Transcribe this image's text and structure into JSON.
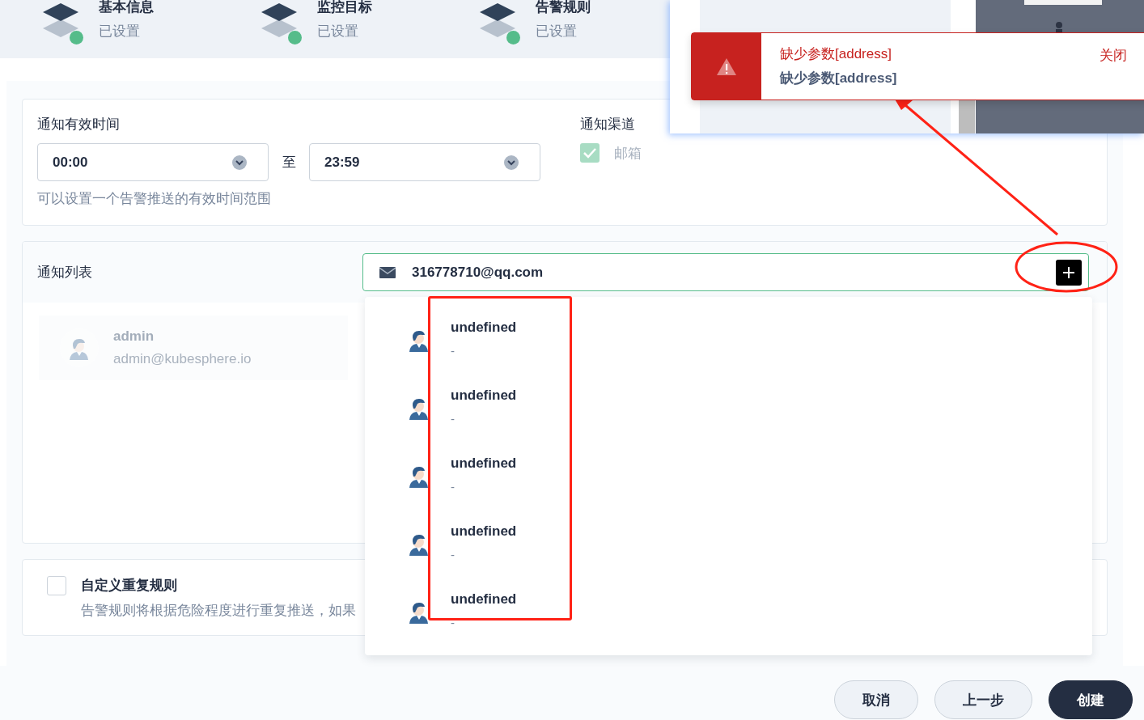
{
  "steps": [
    {
      "title": "基本信息",
      "status": "已设置",
      "done": true
    },
    {
      "title": "监控目标",
      "status": "已设置",
      "done": true
    },
    {
      "title": "告警规则",
      "status": "已设置",
      "done": true
    }
  ],
  "time_card": {
    "label": "通知有效时间",
    "start": "00:00",
    "separator": "至",
    "end": "23:59",
    "hint": "可以设置一个告警推送的有效时间范围"
  },
  "channels": {
    "label": "通知渠道",
    "items": [
      {
        "label": "邮箱",
        "checked": true,
        "disabled": true
      }
    ]
  },
  "notify_list": {
    "label": "通知列表",
    "input_value": "316778710@qq.com",
    "users": [
      {
        "name": "admin",
        "email": "admin@kubesphere.io"
      }
    ]
  },
  "dropdown": {
    "items": [
      {
        "name": "undefined",
        "detail": "-"
      },
      {
        "name": "undefined",
        "detail": "-"
      },
      {
        "name": "undefined",
        "detail": "-"
      },
      {
        "name": "undefined",
        "detail": "-"
      },
      {
        "name": "undefined",
        "detail": "-"
      }
    ]
  },
  "repeat_rule": {
    "checked": false,
    "title": "自定义重复规则",
    "description": "告警规则将根据危险程度进行重复推送，如果"
  },
  "buttons": [
    {
      "label": "取消",
      "kind": "default"
    },
    {
      "label": "上一步",
      "kind": "default"
    },
    {
      "label": "创建",
      "kind": "primary"
    }
  ],
  "notification": {
    "title": "缺少参数[address]",
    "message": "缺少参数[address]",
    "close": "关闭"
  }
}
